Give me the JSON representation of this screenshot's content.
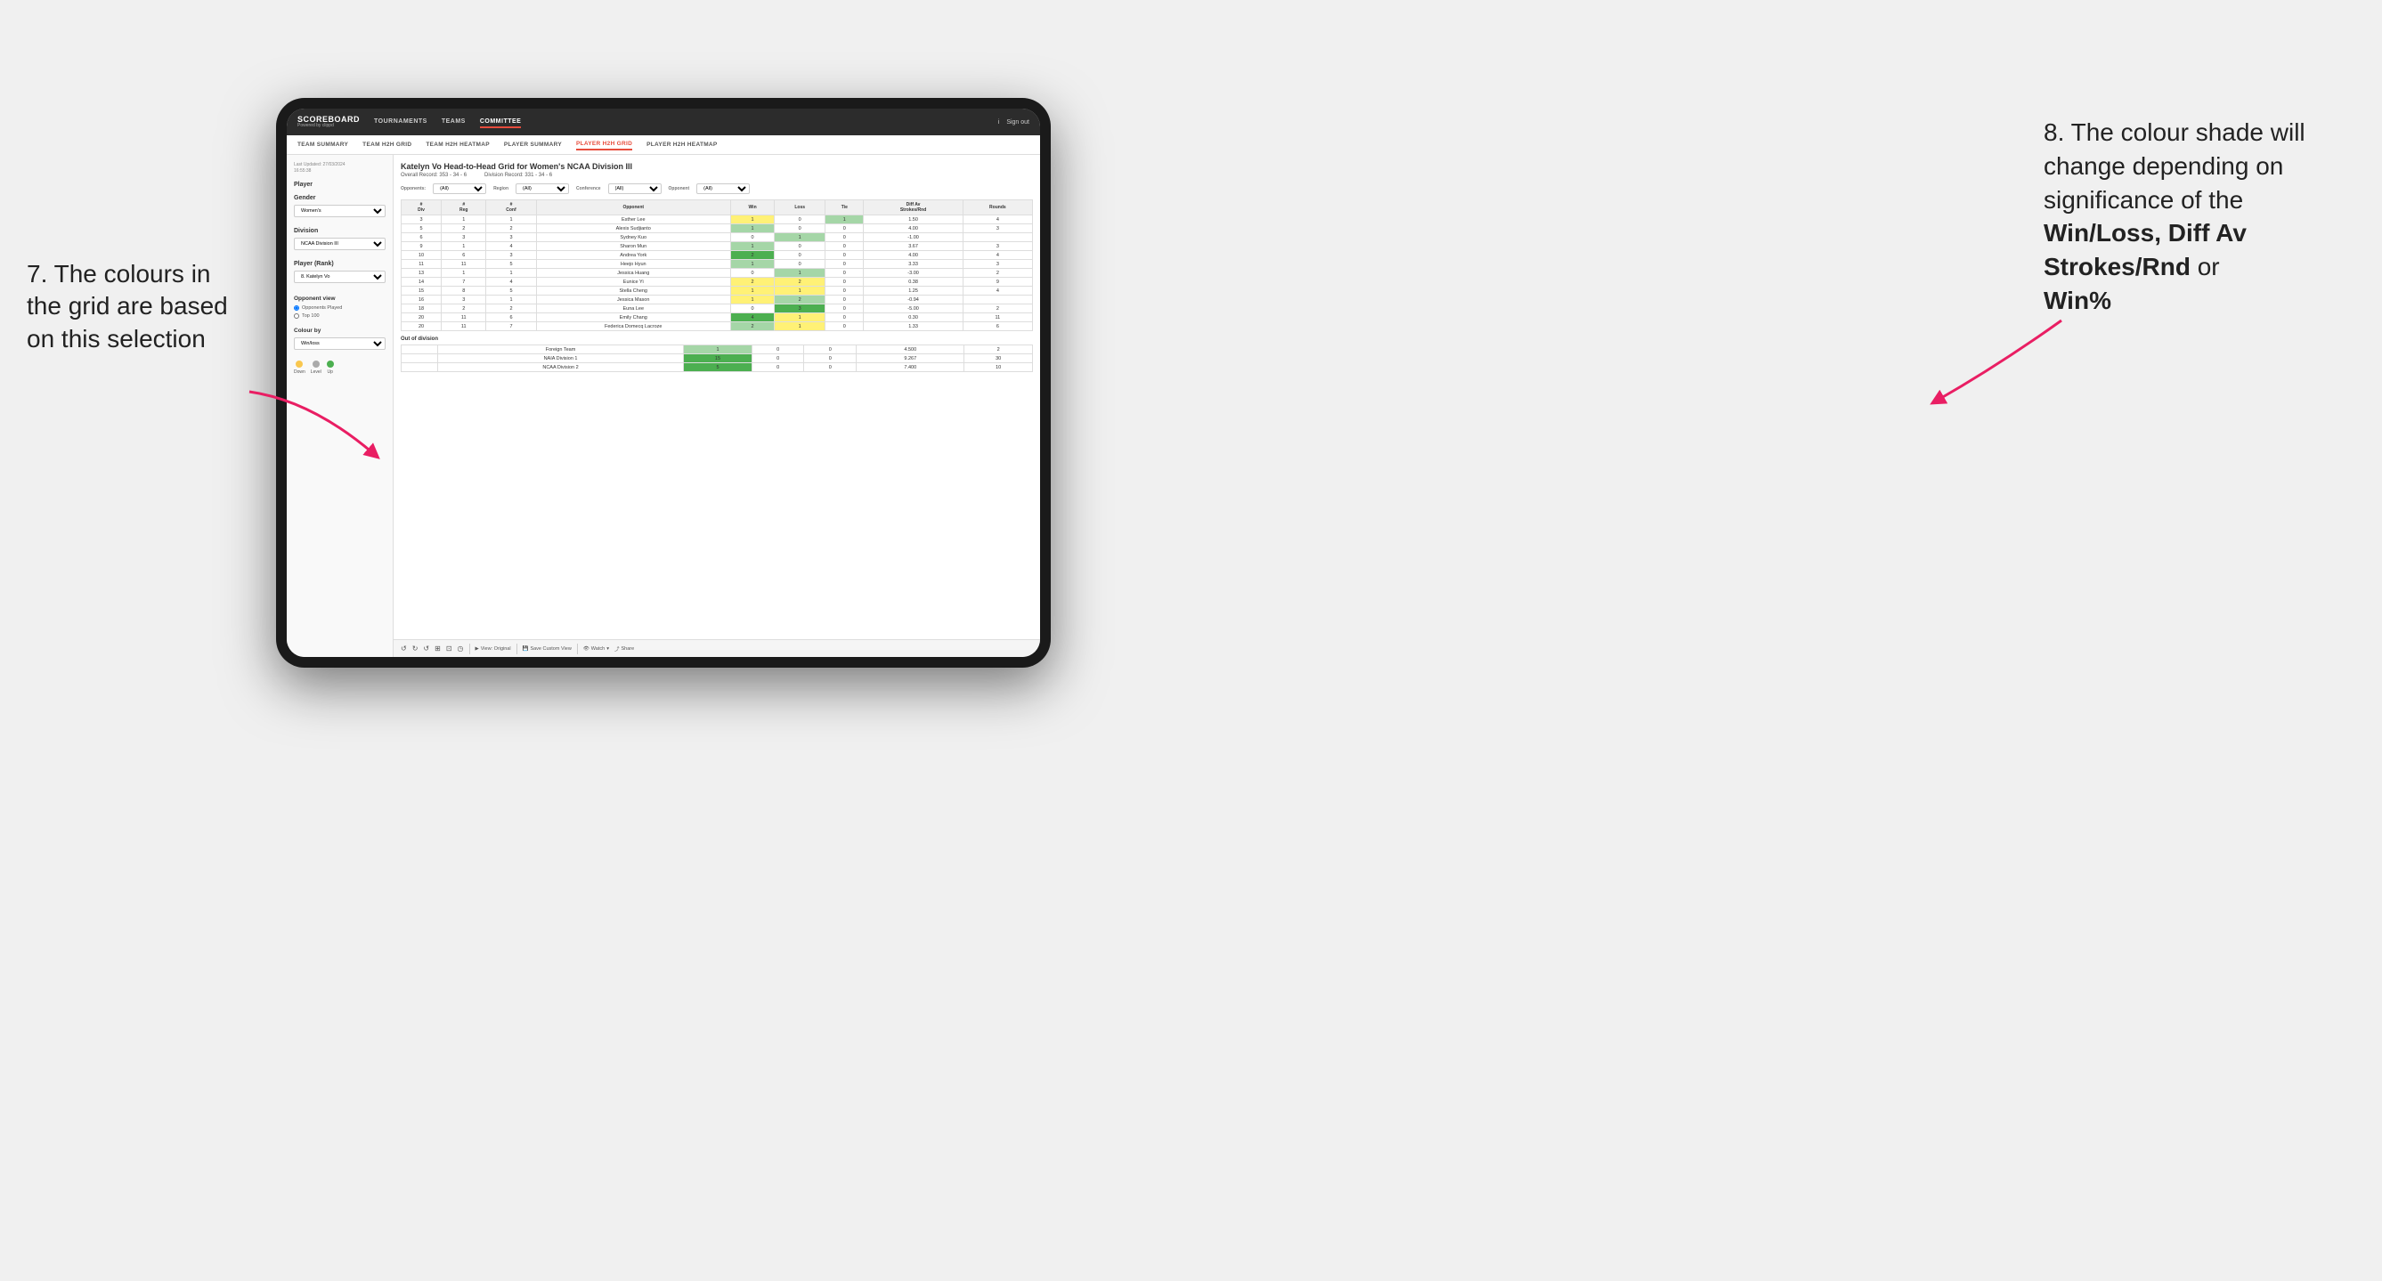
{
  "annotations": {
    "left_title": "7. The colours in the grid are based on this selection",
    "right_title": "8. The colour shade will change depending on significance of the",
    "right_bold1": "Win/Loss, Diff Av Strokes/Rnd",
    "right_bold2": "or",
    "right_bold3": "Win%"
  },
  "nav": {
    "logo": "SCOREBOARD",
    "logo_sub": "Powered by clippd",
    "items": [
      "TOURNAMENTS",
      "TEAMS",
      "COMMITTEE"
    ],
    "active": "COMMITTEE",
    "right_items": [
      "i",
      "Sign out"
    ]
  },
  "sub_nav": {
    "items": [
      "TEAM SUMMARY",
      "TEAM H2H GRID",
      "TEAM H2H HEATMAP",
      "PLAYER SUMMARY",
      "PLAYER H2H GRID",
      "PLAYER H2H HEATMAP"
    ],
    "active": "PLAYER H2H GRID"
  },
  "left_panel": {
    "last_updated_label": "Last Updated: 27/03/2024",
    "last_updated_time": "16:55:38",
    "player_label": "Player",
    "gender_label": "Gender",
    "gender_value": "Women's",
    "division_label": "Division",
    "division_value": "NCAA Division III",
    "player_rank_label": "Player (Rank)",
    "player_rank_value": "8. Katelyn Vo",
    "opponent_view_label": "Opponent view",
    "opponents_played_label": "Opponents Played",
    "top100_label": "Top 100",
    "colour_by_label": "Colour by",
    "colour_by_value": "Win/loss",
    "legend": {
      "down_label": "Down",
      "level_label": "Level",
      "up_label": "Up",
      "down_color": "#f9c74f",
      "level_color": "#aaaaaa",
      "up_color": "#4caf50"
    }
  },
  "grid": {
    "title": "Katelyn Vo Head-to-Head Grid for Women's NCAA Division III",
    "overall_record_label": "Overall Record:",
    "overall_record_value": "353 - 34 - 6",
    "division_record_label": "Division Record:",
    "division_record_value": "331 - 34 - 6",
    "filter_labels": [
      "Opponents:",
      "Region",
      "Conference",
      "Opponent"
    ],
    "filter_values": [
      "(All)",
      "(All)",
      "(All)"
    ],
    "col_headers": [
      "#\nDiv",
      "#\nReg",
      "#\nConf",
      "Opponent",
      "Win",
      "Loss",
      "Tie",
      "Diff Av\nStrokes/Rnd",
      "Rounds"
    ],
    "rows": [
      {
        "div": "3",
        "reg": "1",
        "conf": "1",
        "opponent": "Esther Lee",
        "win": "1",
        "loss": "0",
        "tie": "1",
        "diff": "1.50",
        "rounds": "4",
        "win_color": "yellow",
        "loss_color": "white",
        "tie_color": "green_light"
      },
      {
        "div": "5",
        "reg": "2",
        "conf": "2",
        "opponent": "Alexis Sudjianto",
        "win": "1",
        "loss": "0",
        "tie": "0",
        "diff": "4.00",
        "rounds": "3",
        "win_color": "green_light",
        "loss_color": "white",
        "tie_color": "white"
      },
      {
        "div": "6",
        "reg": "3",
        "conf": "3",
        "opponent": "Sydney Kuo",
        "win": "0",
        "loss": "1",
        "tie": "0",
        "diff": "-1.00",
        "rounds": "",
        "win_color": "white",
        "loss_color": "green_light",
        "tie_color": "white"
      },
      {
        "div": "9",
        "reg": "1",
        "conf": "4",
        "opponent": "Sharon Mun",
        "win": "1",
        "loss": "0",
        "tie": "0",
        "diff": "3.67",
        "rounds": "3",
        "win_color": "green_light",
        "loss_color": "white",
        "tie_color": "white"
      },
      {
        "div": "10",
        "reg": "6",
        "conf": "3",
        "opponent": "Andrea York",
        "win": "2",
        "loss": "0",
        "tie": "0",
        "diff": "4.00",
        "rounds": "4",
        "win_color": "green_dark",
        "loss_color": "white",
        "tie_color": "white"
      },
      {
        "div": "11",
        "reg": "11",
        "conf": "5",
        "opponent": "Heejo Hyun",
        "win": "1",
        "loss": "0",
        "tie": "0",
        "diff": "3.33",
        "rounds": "3",
        "win_color": "green_light",
        "loss_color": "white",
        "tie_color": "white"
      },
      {
        "div": "13",
        "reg": "1",
        "conf": "1",
        "opponent": "Jessica Huang",
        "win": "0",
        "loss": "1",
        "tie": "0",
        "diff": "-3.00",
        "rounds": "2",
        "win_color": "white",
        "loss_color": "green_light",
        "tie_color": "white"
      },
      {
        "div": "14",
        "reg": "7",
        "conf": "4",
        "opponent": "Eunice Yi",
        "win": "2",
        "loss": "2",
        "tie": "0",
        "diff": "0.38",
        "rounds": "9",
        "win_color": "yellow",
        "loss_color": "yellow",
        "tie_color": "white"
      },
      {
        "div": "15",
        "reg": "8",
        "conf": "5",
        "opponent": "Stella Cheng",
        "win": "1",
        "loss": "1",
        "tie": "0",
        "diff": "1.25",
        "rounds": "4",
        "win_color": "yellow",
        "loss_color": "yellow",
        "tie_color": "white"
      },
      {
        "div": "16",
        "reg": "3",
        "conf": "1",
        "opponent": "Jessica Mason",
        "win": "1",
        "loss": "2",
        "tie": "0",
        "diff": "-0.94",
        "rounds": "",
        "win_color": "yellow",
        "loss_color": "green_light",
        "tie_color": "white"
      },
      {
        "div": "18",
        "reg": "2",
        "conf": "2",
        "opponent": "Euna Lee",
        "win": "0",
        "loss": "3",
        "tie": "0",
        "diff": "-5.00",
        "rounds": "2",
        "win_color": "white",
        "loss_color": "green_dark",
        "tie_color": "white"
      },
      {
        "div": "20",
        "reg": "11",
        "conf": "6",
        "opponent": "Emily Chang",
        "win": "4",
        "loss": "1",
        "tie": "0",
        "diff": "0.30",
        "rounds": "11",
        "win_color": "green_dark",
        "loss_color": "yellow",
        "tie_color": "white"
      },
      {
        "div": "20",
        "reg": "11",
        "conf": "7",
        "opponent": "Federica Domecq Lacroze",
        "win": "2",
        "loss": "1",
        "tie": "0",
        "diff": "1.33",
        "rounds": "6",
        "win_color": "green_light",
        "loss_color": "yellow",
        "tie_color": "white"
      }
    ],
    "out_of_division_label": "Out of division",
    "out_of_division_rows": [
      {
        "opponent": "Foreign Team",
        "win": "1",
        "loss": "0",
        "tie": "0",
        "diff": "4.500",
        "rounds": "2",
        "win_color": "green_light"
      },
      {
        "opponent": "NAIA Division 1",
        "win": "15",
        "loss": "0",
        "tie": "0",
        "diff": "9.267",
        "rounds": "30",
        "win_color": "green_dark"
      },
      {
        "opponent": "NCAA Division 2",
        "win": "5",
        "loss": "0",
        "tie": "0",
        "diff": "7.400",
        "rounds": "10",
        "win_color": "green_dark"
      }
    ]
  },
  "toolbar": {
    "view_original": "View: Original",
    "save_custom": "Save Custom View",
    "watch": "Watch",
    "share": "Share"
  }
}
